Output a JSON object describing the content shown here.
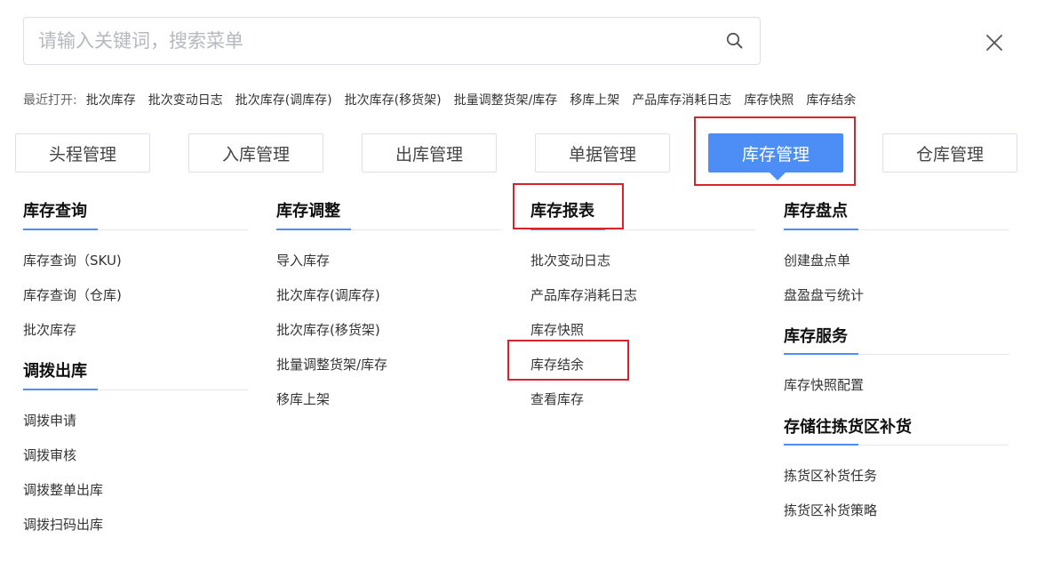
{
  "search": {
    "placeholder": "请输入关键词，搜索菜单",
    "value": ""
  },
  "icons": {
    "search": "search-icon",
    "close": "close-icon"
  },
  "colors": {
    "accent": "#4d8ef6",
    "highlight": "#d9232b"
  },
  "recent": {
    "label": "最近打开:",
    "items": [
      "批次库存",
      "批次变动日志",
      "批次库存(调库存)",
      "批次库存(移货架)",
      "批量调整货架/库存",
      "移库上架",
      "产品库存消耗日志",
      "库存快照",
      "库存结余"
    ]
  },
  "tabs": [
    {
      "label": "头程管理",
      "active": false
    },
    {
      "label": "入库管理",
      "active": false
    },
    {
      "label": "出库管理",
      "active": false
    },
    {
      "label": "单据管理",
      "active": false
    },
    {
      "label": "库存管理",
      "active": true
    },
    {
      "label": "仓库管理",
      "active": false
    }
  ],
  "sections": {
    "stock_query": {
      "title": "库存查询",
      "items": [
        "库存查询（SKU)",
        "库存查询（仓库)",
        "批次库存"
      ]
    },
    "transfer_out": {
      "title": "调拨出库",
      "items": [
        "调拨申请",
        "调拨审核",
        "调拨整单出库",
        "调拨扫码出库"
      ]
    },
    "stock_adjust": {
      "title": "库存调整",
      "items": [
        "导入库存",
        "批次库存(调库存)",
        "批次库存(移货架)",
        "批量调整货架/库存",
        "移库上架"
      ]
    },
    "stock_report": {
      "title": "库存报表",
      "items": [
        "批次变动日志",
        "产品库存消耗日志",
        "库存快照",
        "库存结余",
        "查看库存"
      ]
    },
    "stock_count": {
      "title": "库存盘点",
      "items": [
        "创建盘点单",
        "盘盈盘亏统计"
      ]
    },
    "stock_service": {
      "title": "库存服务",
      "items": [
        "库存快照配置"
      ]
    },
    "replenish": {
      "title": "存储往拣货区补货",
      "items": [
        "拣货区补货任务",
        "拣货区补货策略"
      ]
    }
  }
}
